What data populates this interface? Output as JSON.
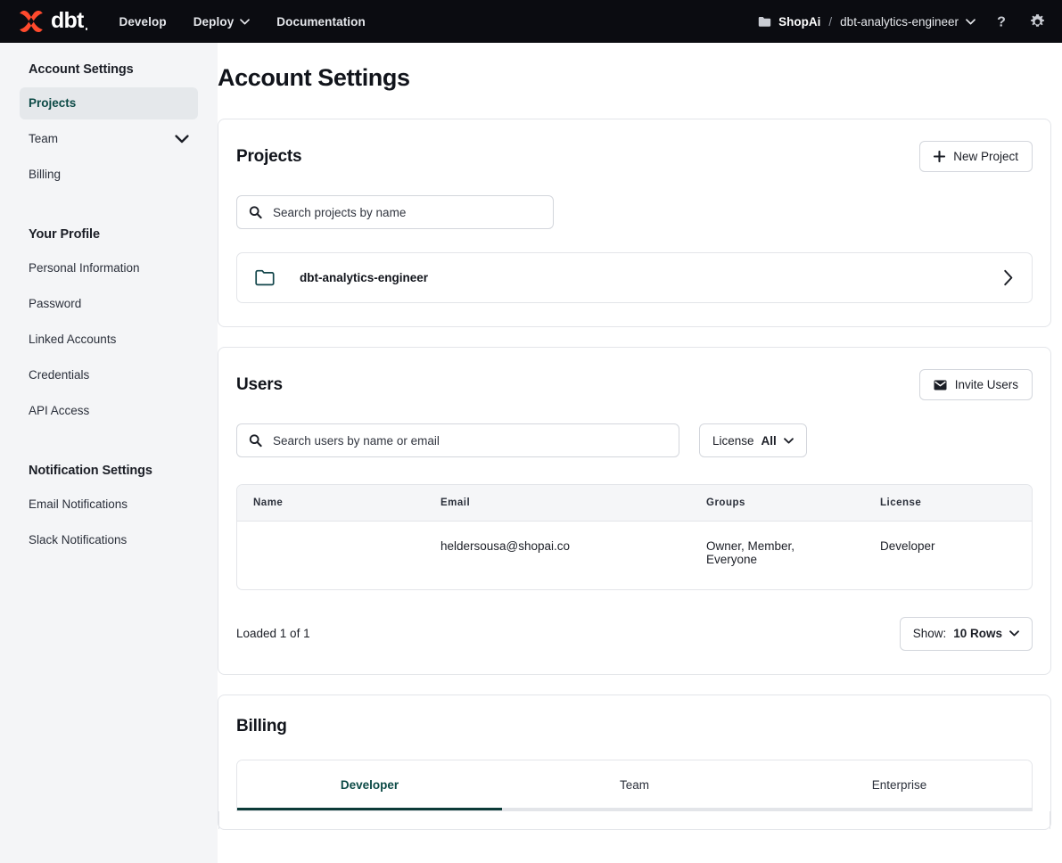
{
  "topbar": {
    "logo_text": "dbt",
    "logo_icon": "dbt-logo-icon",
    "nav": [
      {
        "label": "Develop",
        "has_caret": false
      },
      {
        "label": "Deploy",
        "has_caret": true
      },
      {
        "label": "Documentation",
        "has_caret": false
      }
    ],
    "account": {
      "folder_icon": "folder-filled-icon",
      "organization": "ShopAi",
      "separator": "/",
      "project": "dbt-analytics-engineer",
      "caret_icon": "chevron-down-icon"
    },
    "help_icon": "question-mark-icon",
    "settings_icon": "gear-icon"
  },
  "sidebar": {
    "groups": [
      {
        "title": "Account Settings",
        "items": [
          {
            "label": "Projects",
            "active": true,
            "caret": false
          },
          {
            "label": "Team",
            "active": false,
            "caret": true
          },
          {
            "label": "Billing",
            "active": false,
            "caret": false
          }
        ]
      },
      {
        "title": "Your Profile",
        "items": [
          {
            "label": "Personal Information",
            "active": false,
            "caret": false
          },
          {
            "label": "Password",
            "active": false,
            "caret": false
          },
          {
            "label": "Linked Accounts",
            "active": false,
            "caret": false
          },
          {
            "label": "Credentials",
            "active": false,
            "caret": false
          },
          {
            "label": "API Access",
            "active": false,
            "caret": false
          }
        ]
      },
      {
        "title": "Notification Settings",
        "items": [
          {
            "label": "Email Notifications",
            "active": false,
            "caret": false
          },
          {
            "label": "Slack Notifications",
            "active": false,
            "caret": false
          }
        ]
      }
    ]
  },
  "main": {
    "page_title": "Account Settings",
    "projects_card": {
      "title": "Projects",
      "new_project_button": "New Project",
      "new_project_icon": "plus-icon",
      "search_placeholder": "Search projects by name",
      "search_value": "",
      "search_icon": "search-icon",
      "rows": [
        {
          "name": "dbt-analytics-engineer",
          "folder_icon": "folder-outline-icon",
          "chevron_icon": "chevron-right-icon"
        }
      ]
    },
    "users_card": {
      "title": "Users",
      "invite_button": "Invite Users",
      "invite_icon": "envelope-icon",
      "search_placeholder": "Search users by name or email",
      "search_value": "",
      "search_icon": "search-icon",
      "license_filter": {
        "label": "License",
        "value": "All",
        "caret_icon": "chevron-down-icon"
      },
      "columns": [
        "Name",
        "Email",
        "Groups",
        "License"
      ],
      "rows": [
        {
          "name": "",
          "email": "heldersousa@shopai.co",
          "groups": "Owner, Member, Everyone",
          "license": "Developer"
        }
      ],
      "loaded_text": "Loaded 1 of 1",
      "rows_select": {
        "label": "Show:",
        "value": "10 Rows",
        "caret_icon": "chevron-down-icon"
      }
    },
    "billing_card": {
      "title": "Billing",
      "tabs": [
        {
          "label": "Developer",
          "active": true
        },
        {
          "label": "Team",
          "active": false
        },
        {
          "label": "Enterprise",
          "active": false
        }
      ]
    }
  },
  "colors": {
    "brand_orange": "#ff4a2d",
    "topbar_bg": "#0b0c11",
    "sidebar_bg": "#f4f5f7",
    "accent_teal": "#0c4a46",
    "border": "#e3e5e9"
  }
}
